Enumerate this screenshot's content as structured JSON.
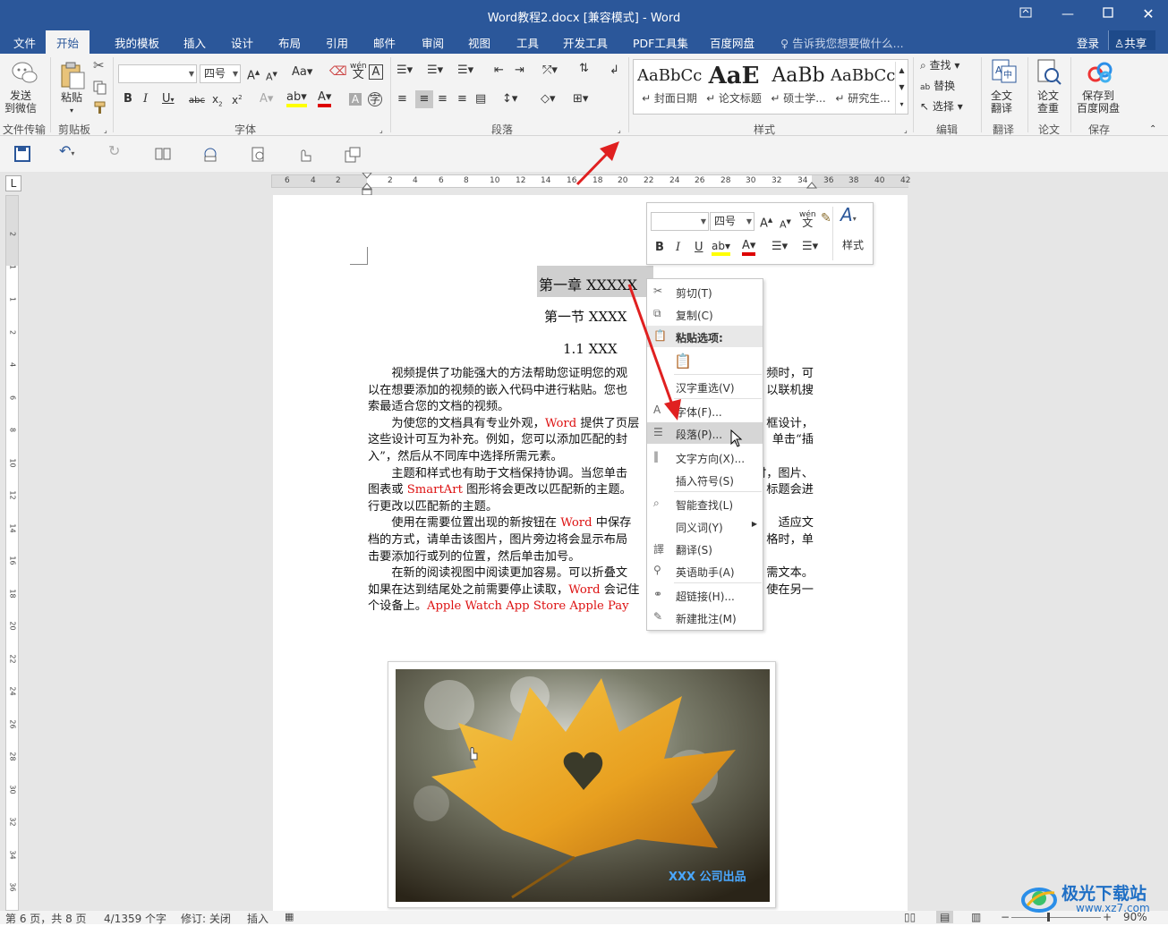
{
  "window": {
    "title": "Word教程2.docx [兼容模式] - Word"
  },
  "tabs": [
    "文件",
    "开始",
    "我的模板",
    "插入",
    "设计",
    "布局",
    "引用",
    "邮件",
    "审阅",
    "视图",
    "工具",
    "开发工具",
    "PDF工具集",
    "百度网盘"
  ],
  "active_tab": "开始",
  "tell_me": "告诉我您想要做什么...",
  "login": "登录",
  "share": "共享",
  "ribbon": {
    "send_wechat": "发送\n到微信",
    "paste": "粘贴",
    "font_name": "",
    "font_size": "四号",
    "style_items": [
      {
        "sample": "AaBbCc",
        "name": "↵ 封面日期"
      },
      {
        "sample": "AaE",
        "name": "↵ 论文标题"
      },
      {
        "sample": "AaBb",
        "name": "↵ 硕士学..."
      },
      {
        "sample": "AaBbCc",
        "name": "↵ 研究生..."
      }
    ],
    "find": "查找",
    "replace": "替换",
    "select": "选择",
    "full_translate": "全文\n翻译",
    "paper_check": "论文\n查重",
    "save_baidu": "保存到\n百度网盘",
    "groups": [
      "文件传输",
      "剪贴板",
      "字体",
      "段落",
      "样式",
      "编辑",
      "翻译",
      "论文",
      "保存"
    ]
  },
  "ruler": {
    "h_ticks": [
      "6",
      "4",
      "2",
      "2",
      "4",
      "6",
      "8",
      "10",
      "12",
      "14",
      "16",
      "18",
      "20",
      "22",
      "24",
      "26",
      "28",
      "30",
      "32",
      "34",
      "36",
      "38",
      "40",
      "42"
    ],
    "v_ticks": [
      "2",
      "1",
      "1",
      "2",
      "4",
      "6",
      "8",
      "10",
      "12",
      "14",
      "16",
      "18",
      "20",
      "22",
      "24",
      "26",
      "28",
      "30",
      "32",
      "34",
      "36",
      "38"
    ],
    "tab_selector": "L"
  },
  "document": {
    "heading1": "第一章  XXXXX",
    "heading2": "第一节  XXXX",
    "heading3": "1.1 XXX",
    "lines": [
      [
        {
          "t": "　　视频提供了功能强大的方法帮助您证明您的观"
        },
        {
          "t": "频时，可",
          "gap": true
        }
      ],
      [
        {
          "t": "以在想要添加的视频的嵌入代码中进行粘贴。您也"
        },
        {
          "t": "以联机搜",
          "gap": true
        }
      ],
      [
        {
          "t": "索最适合您的文档的视频。"
        }
      ],
      [
        {
          "t": "　　为使您的文档具有专业外观，"
        },
        {
          "t": "Word",
          "red": true
        },
        {
          "t": " 提供了页层"
        },
        {
          "t": "框设计，",
          "gap": true
        }
      ],
      [
        {
          "t": "这些设计可互为补充。例如，您可以添加匹配的封"
        },
        {
          "t": "单击“插",
          "gap": true
        }
      ],
      [
        {
          "t": "入”，然后从不同库中选择所需元素。"
        }
      ],
      [
        {
          "t": "　　主题和样式也有助于文档保持协调。当您单击"
        },
        {
          "t": "时，图片、",
          "gap": true
        }
      ],
      [
        {
          "t": "图表或 "
        },
        {
          "t": "SmartArt",
          "red": true
        },
        {
          "t": " 图形将会更改以匹配新的主题。"
        },
        {
          "t": "标题会进",
          "gap": true
        }
      ],
      [
        {
          "t": "行更改以匹配新的主题。"
        }
      ],
      [
        {
          "t": "　　使用在需要位置出现的新按钮在 "
        },
        {
          "t": "Word",
          "red": true
        },
        {
          "t": " 中保存"
        },
        {
          "t": "适应文",
          "gap": true
        }
      ],
      [
        {
          "t": "档的方式，请单击该图片，图片旁边将会显示布局"
        },
        {
          "t": "格时，单",
          "gap": true
        }
      ],
      [
        {
          "t": "击要添加行或列的位置，然后单击加号。"
        }
      ],
      [
        {
          "t": "　　在新的阅读视图中阅读更加容易。可以折叠文"
        },
        {
          "t": "需文本。",
          "gap": true
        }
      ],
      [
        {
          "t": "如果在达到结尾处之前需要停止读取，"
        },
        {
          "t": "Word",
          "red": true
        },
        {
          "t": " 会记住"
        },
        {
          "t": "使在另一",
          "gap": true
        }
      ],
      [
        {
          "t": "个设备上。"
        },
        {
          "t": "Apple Watch",
          "red": true
        },
        {
          "t": "   "
        },
        {
          "t": "App Store",
          "red": true
        },
        {
          "t": "   "
        },
        {
          "t": "Apple Pay",
          "red": true
        }
      ]
    ],
    "image_caption": "XXX 公司出品"
  },
  "mini_toolbar": {
    "font_name": "",
    "font_size": "四号",
    "styles_label": "样式"
  },
  "context_menu": {
    "items": [
      {
        "label": "剪切(T)",
        "icon": "scissors-icon"
      },
      {
        "label": "复制(C)",
        "icon": "copy-icon"
      },
      {
        "label": "粘贴选项:",
        "icon": "paste-icon",
        "header": true
      },
      {
        "label": "",
        "icon": "paste-keep-icon",
        "paste": true
      },
      {
        "label": "汉字重选(V)",
        "icon": "",
        "sep_before": true
      },
      {
        "label": "字体(F)...",
        "icon": "font-icon",
        "sep_before": true
      },
      {
        "label": "段落(P)...",
        "icon": "paragraph-icon",
        "highlight": true
      },
      {
        "label": "文字方向(X)...",
        "icon": "text-direction-icon"
      },
      {
        "label": "插入符号(S)",
        "icon": ""
      },
      {
        "label": "智能查找(L)",
        "icon": "smart-lookup-icon",
        "sep_before": true
      },
      {
        "label": "同义词(Y)",
        "icon": "",
        "submenu": true
      },
      {
        "label": "翻译(S)",
        "icon": "translate-icon"
      },
      {
        "label": "英语助手(A)",
        "icon": "english-assistant-icon"
      },
      {
        "label": "超链接(H)...",
        "icon": "hyperlink-icon",
        "sep_before": true
      },
      {
        "label": "新建批注(M)",
        "icon": "new-comment-icon"
      }
    ]
  },
  "status": {
    "page": "第 6 页，共 8 页",
    "words": "4/1359 个字",
    "track": "修订: 关闭",
    "mode": "插入",
    "zoom": "90%"
  },
  "watermark": "极光下载站",
  "watermark_url": "www.xz7.com",
  "colors": {
    "brand": "#2b579a",
    "arrow": "#e02020",
    "red_text": "#d11111"
  }
}
